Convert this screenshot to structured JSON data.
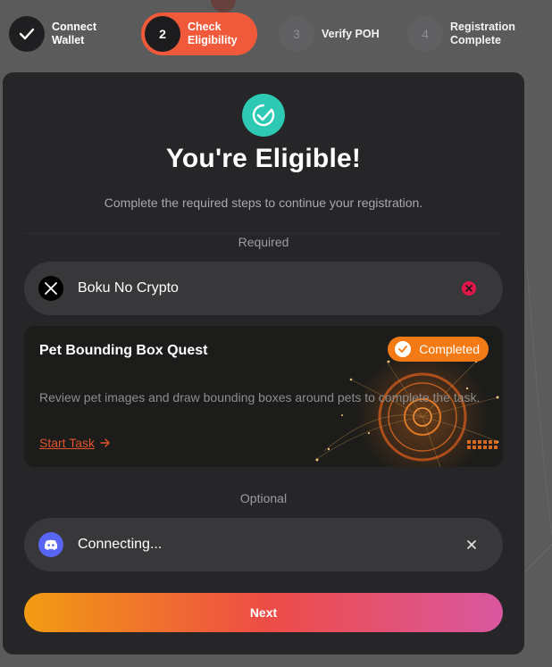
{
  "stepper": {
    "steps": [
      {
        "number": "",
        "label_line1": "Connect",
        "label_line2": "Wallet",
        "state": "done"
      },
      {
        "number": "2",
        "label_line1": "Check",
        "label_line2": "Eligibility",
        "state": "active"
      },
      {
        "number": "3",
        "label_line1": "Verify POH",
        "label_line2": "",
        "state": "pending"
      },
      {
        "number": "4",
        "label_line1": "Registration",
        "label_line2": "Complete",
        "state": "pending"
      }
    ]
  },
  "card": {
    "title": "You're Eligible!",
    "subtitle": "Complete the required steps to continue your registration.",
    "required_label": "Required",
    "optional_label": "Optional"
  },
  "twitter_row": {
    "icon": "x-logo-icon",
    "handle": "Boku No Crypto",
    "status_icon": "error-remove-icon"
  },
  "quest": {
    "title": "Pet Bounding Box Quest",
    "badge": "Completed",
    "description": "Review pet images and draw bounding boxes around pets to complete the task.",
    "link_label": "Start Task"
  },
  "discord_row": {
    "icon": "discord-logo-icon",
    "status_text": "Connecting...",
    "close_icon": "close-icon"
  },
  "next_button": "Next",
  "colors": {
    "accent_orange": "#f05a3a",
    "success_teal": "#2ec9b5",
    "badge_orange": "#f47a16",
    "error_red": "#e3164a",
    "discord_blurple": "#5865f2"
  }
}
